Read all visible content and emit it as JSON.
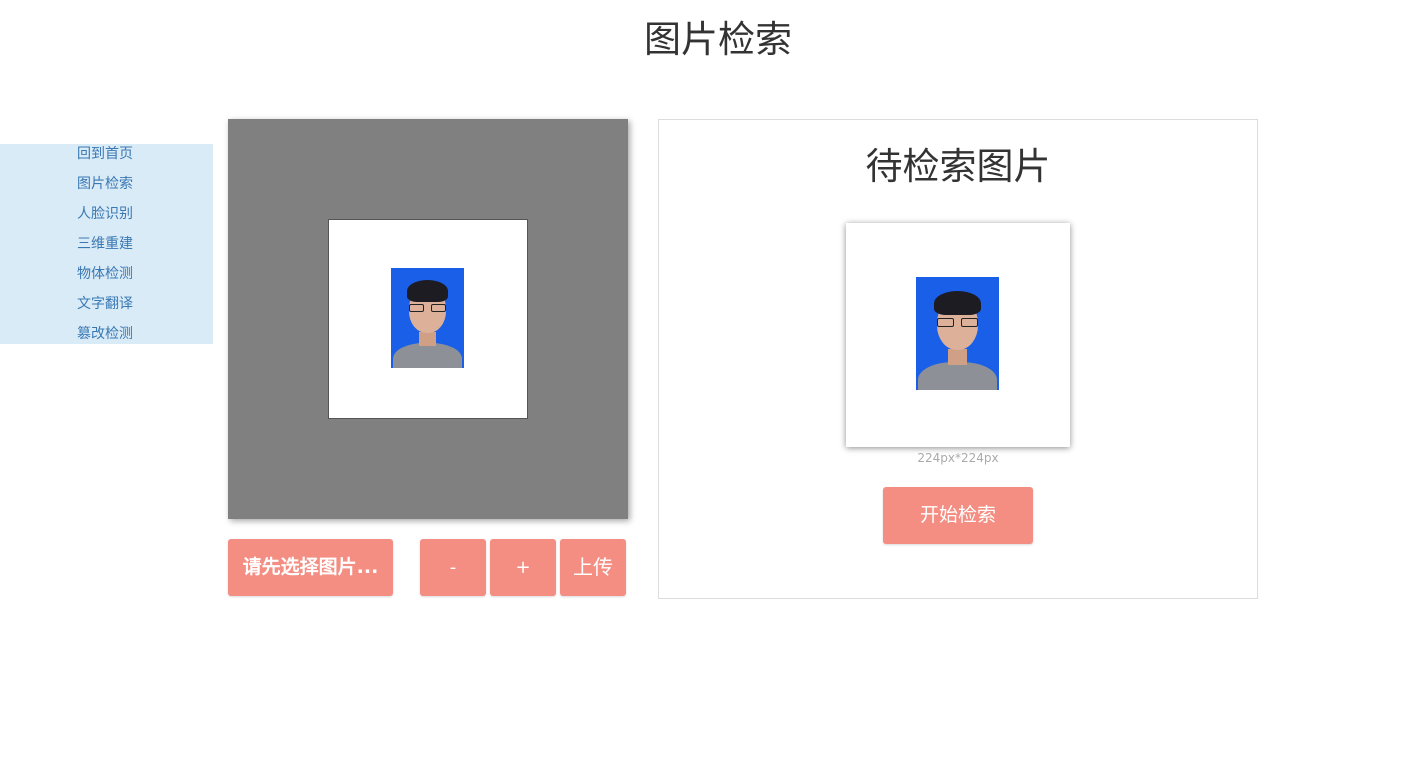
{
  "header": {
    "title": "图片检索"
  },
  "sidebar": {
    "items": [
      {
        "label": "回到首页"
      },
      {
        "label": "图片检索"
      },
      {
        "label": "人脸识别"
      },
      {
        "label": "三维重建"
      },
      {
        "label": "物体检测"
      },
      {
        "label": "文字翻译"
      },
      {
        "label": "篡改检测"
      }
    ]
  },
  "editor": {
    "select_button": "请先选择图片...",
    "zoom_out_button": "-",
    "zoom_in_button": "+",
    "upload_button": "上传"
  },
  "panel": {
    "title": "待检索图片",
    "size_caption": "224px*224px",
    "search_button": "开始检索"
  },
  "colors": {
    "accent": "#f48e82",
    "sidebar_bg": "#d9ebf6",
    "sidebar_link": "#3a78b4",
    "editor_bg": "#808080",
    "photo_bg": "#1a5fe8"
  }
}
